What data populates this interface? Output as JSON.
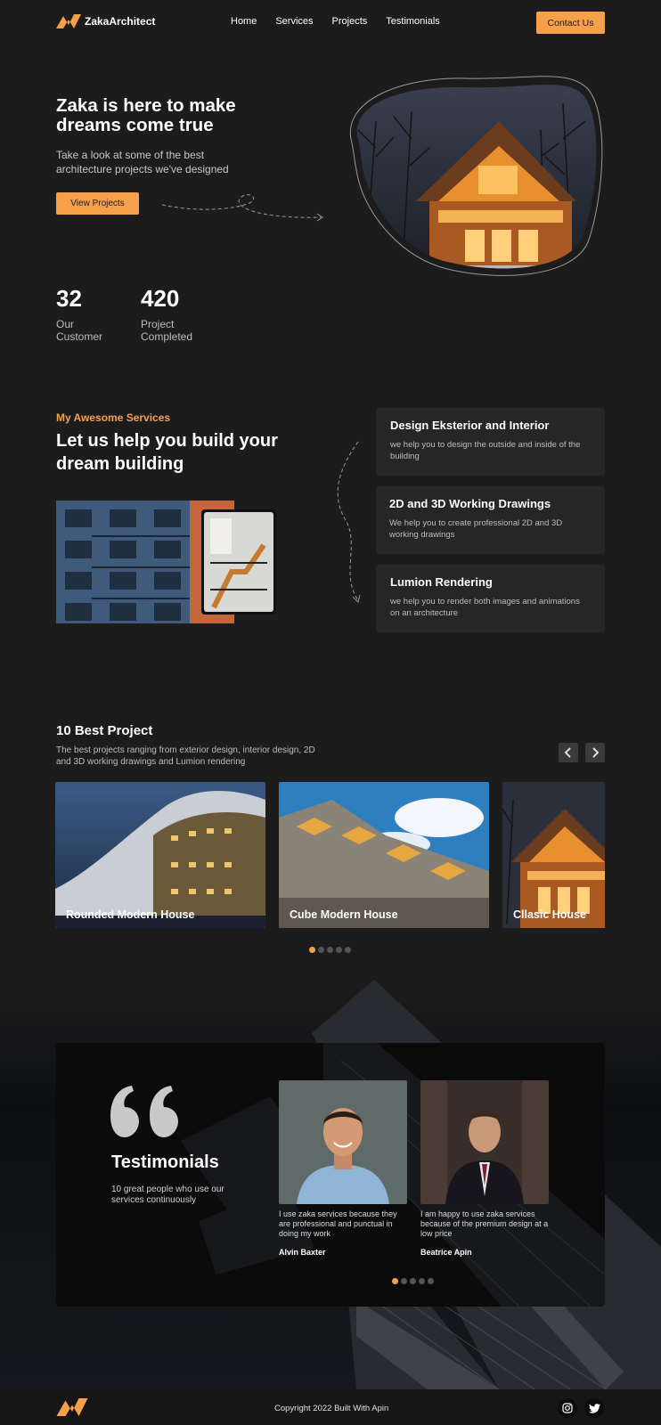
{
  "nav": {
    "logo_text": "ZakaArchitect",
    "links": [
      "Home",
      "Services",
      "Projects",
      "Testimonials"
    ],
    "contact_label": "Contact Us"
  },
  "hero": {
    "title": "Zaka is here to make dreams come true",
    "subtitle": "Take a look at some of the best architecture projects we've designed",
    "button_label": "View Projects",
    "stats": [
      {
        "value": "32",
        "label": "Our Customer"
      },
      {
        "value": "420",
        "label": "Project Completed"
      }
    ]
  },
  "services": {
    "kicker": "My Awesome Services",
    "title": "Let us help you build your dream building",
    "items": [
      {
        "title": "Design Eksterior and Interior",
        "desc": "we help you to design the outside and inside of the building"
      },
      {
        "title": "2D and 3D Working Drawings",
        "desc": "We help you to create professional 2D and 3D working drawings"
      },
      {
        "title": "Lumion Rendering",
        "desc": "we help you to render both images and animations on an architecture"
      }
    ]
  },
  "projects": {
    "title": "10 Best Project",
    "desc": "The best projects ranging from exterior design, interior design, 2D and 3D working drawings and Lumion rendering",
    "items": [
      {
        "label": "Rounded Modern House"
      },
      {
        "label": "Cube Modern House"
      },
      {
        "label": "Cllasic House"
      }
    ],
    "dots": 5,
    "active_dot": 0
  },
  "testimonials": {
    "title": "Testimonials",
    "subtitle": "10 great people who use our services continuously",
    "items": [
      {
        "quote": "I use zaka services because they are professional and punctual in doing my work",
        "name": "Alvin Baxter"
      },
      {
        "quote": "I am happy to use zaka services because of the premium design at a low price",
        "name": "Beatrice Apin"
      }
    ],
    "dots": 5,
    "active_dot": 0
  },
  "footer": {
    "copyright": "Copyright 2022 Built With Apin",
    "social_icons": [
      "instagram-icon",
      "twitter-icon"
    ]
  },
  "colors": {
    "accent": "#f7a04b",
    "background": "#1c1c1c",
    "card": "#262626"
  }
}
